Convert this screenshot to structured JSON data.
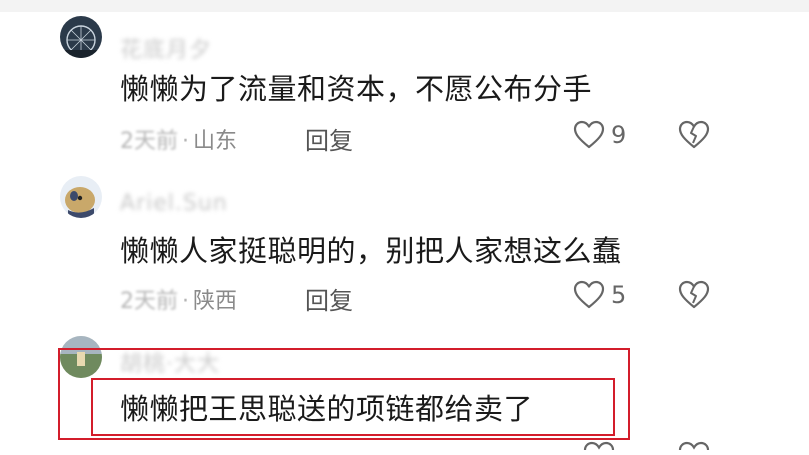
{
  "comments": [
    {
      "username": "花底月夕",
      "content": "懒懒为了流量和资本，不愿公布分手",
      "time": "2天前",
      "separator": "·",
      "location": "山东",
      "reply_label": "回复",
      "like_count": "9",
      "avatar_colors": [
        "#2b3a4a",
        "#9fb0c0"
      ]
    },
    {
      "username": "Ariel.Sun",
      "content": "懒懒人家挺聪明的，别把人家想这么蠢",
      "time": "2天前",
      "separator": "·",
      "location": "陕西",
      "reply_label": "回复",
      "like_count": "5",
      "avatar_colors": [
        "#3d4a6b",
        "#c9a86a"
      ]
    },
    {
      "username": "胡桃·大大",
      "content": "懒懒把王思聪送的项链都给卖了",
      "avatar_colors": [
        "#8fa08a",
        "#e8d9b0"
      ]
    }
  ],
  "highlight_color": "#d31d2b"
}
